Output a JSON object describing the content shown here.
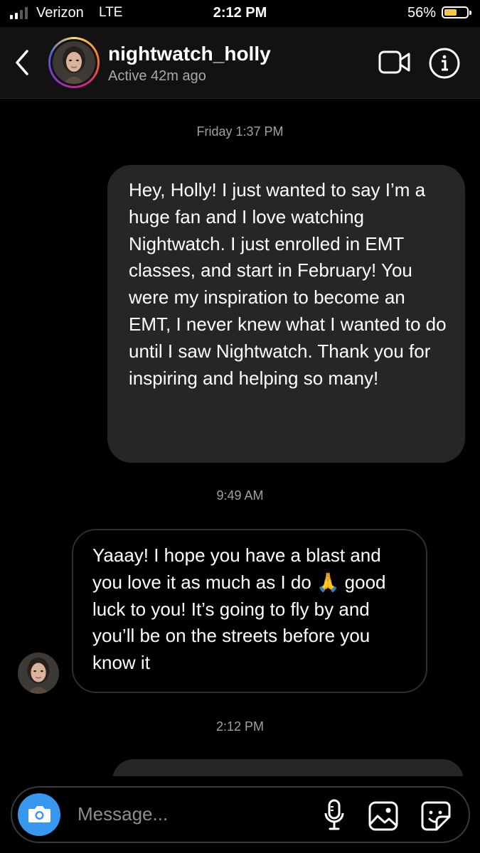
{
  "status_bar": {
    "carrier": "Verizon",
    "network": "LTE",
    "time": "2:12 PM",
    "battery": "56%",
    "battery_level": 0.56,
    "signal_bars": 2
  },
  "header": {
    "username": "nightwatch_holly",
    "status": "Active 42m ago",
    "icons": [
      "back-chevron-icon",
      "video-call-icon",
      "info-icon"
    ]
  },
  "messages": [
    {
      "type": "timestamp",
      "text": "Friday 1:37 PM"
    },
    {
      "type": "outgoing",
      "text": "Hey, Holly! I just wanted to say I’m a huge fan and I love watching Nightwatch. I just enrolled in EMT classes, and start in February! You were my inspiration to become an EMT, I never knew what I wanted to do until I saw Nightwatch. Thank you for inspiring and helping so many!"
    },
    {
      "type": "timestamp",
      "text": "9:49 AM"
    },
    {
      "type": "incoming",
      "text": "Yaaay! I hope you have a blast and you love it as much as I do 🙏 good luck to you! It’s going to fly by and you’ll be on the streets before you know it"
    },
    {
      "type": "timestamp",
      "text": "2:12 PM"
    }
  ],
  "composer": {
    "placeholder": "Message...",
    "icons": [
      "camera-icon",
      "microphone-icon",
      "gallery-icon",
      "sticker-icon"
    ]
  },
  "colors": {
    "background": "#000000",
    "outgoing_bubble": "#262626",
    "camera_button": "#3897f0",
    "battery_fill": "#f4c942"
  }
}
